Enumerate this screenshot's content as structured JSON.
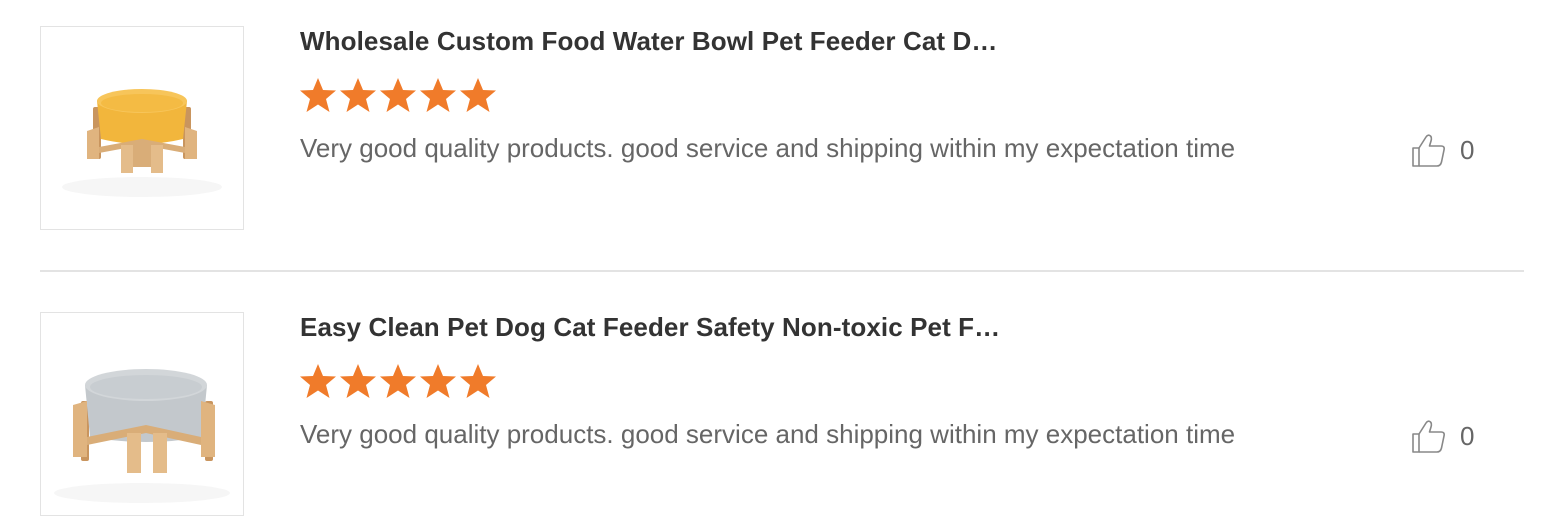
{
  "reviews": [
    {
      "title": "Wholesale Custom Food Water Bowl Pet Feeder Cat D…",
      "rating": 5,
      "comment": "Very good quality products. good service and shipping within my expectation time",
      "likes": "0",
      "bowl_color": "#f2b63c"
    },
    {
      "title": "Easy Clean Pet Dog Cat Feeder Safety Non-toxic Pet F…",
      "rating": 5,
      "comment": "Very good quality products. good service and shipping within my expectation time",
      "likes": "0",
      "bowl_color": "#c3c8cc"
    }
  ],
  "colors": {
    "star": "#f07b2a",
    "title": "#333333",
    "text": "#666666",
    "border": "#e3e3e3",
    "wood": "#d9ad78"
  },
  "icons": {
    "rating": "star-icon",
    "like": "thumbs-up-icon"
  }
}
